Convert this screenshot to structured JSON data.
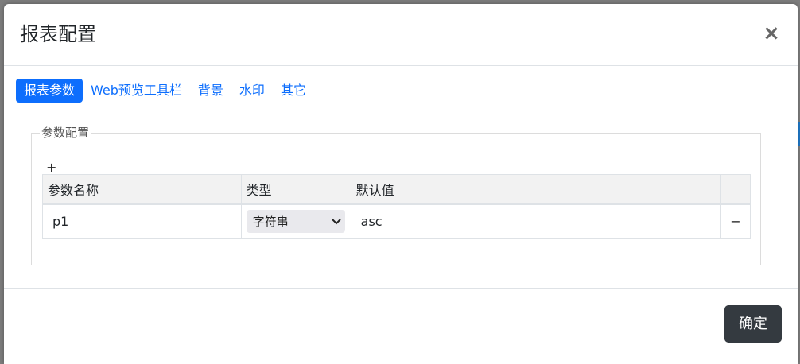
{
  "modal": {
    "title": "报表配置",
    "close_icon": "close-icon"
  },
  "tabs": [
    {
      "label": "报表参数",
      "active": true
    },
    {
      "label": "Web预览工具栏",
      "active": false
    },
    {
      "label": "背景",
      "active": false
    },
    {
      "label": "水印",
      "active": false
    },
    {
      "label": "其它",
      "active": false
    }
  ],
  "params": {
    "legend": "参数配置",
    "add_label": "+",
    "columns": [
      "参数名称",
      "类型",
      "默认值",
      ""
    ],
    "rows": [
      {
        "name": "p1",
        "type": "字符串",
        "default": "asc",
        "delete_label": "−"
      }
    ]
  },
  "footer": {
    "ok_label": "确定"
  },
  "colors": {
    "primary": "#0d6efd",
    "dark_button": "#343a40",
    "header_bg": "#f2f2f2"
  }
}
